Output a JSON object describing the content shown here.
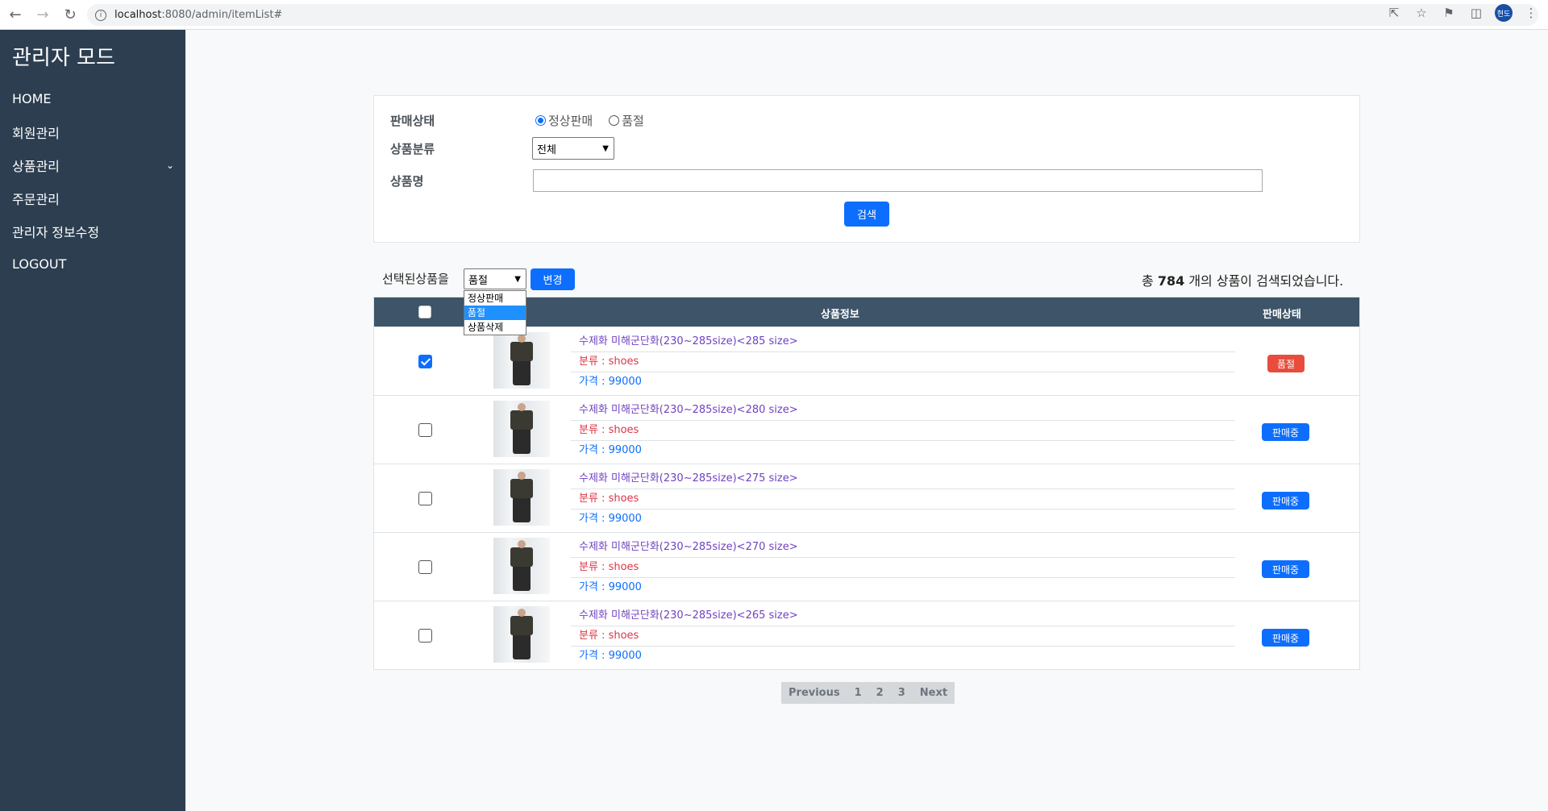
{
  "browser": {
    "url_host": "localhost",
    "url_rest": ":8080/admin/itemList#",
    "profile_initials": "현도"
  },
  "sidebar": {
    "title": "관리자 모드",
    "items": [
      {
        "label": "HOME"
      },
      {
        "label": "회원관리"
      },
      {
        "label": "상품관리"
      },
      {
        "label": "주문관리"
      },
      {
        "label": "관리자 정보수정"
      },
      {
        "label": "LOGOUT"
      }
    ]
  },
  "search": {
    "status_label": "판매상태",
    "status_options": [
      "정상판매",
      "품절"
    ],
    "status_selected": "정상판매",
    "category_label": "상품분류",
    "category_value": "전체",
    "name_label": "상품명",
    "name_value": "",
    "search_button": "검색"
  },
  "bulk": {
    "label": "선택된상품을",
    "selected": "품절",
    "options": [
      "정상판매",
      "품절",
      "상품삭제"
    ],
    "change_button": "변경"
  },
  "summary": {
    "prefix": "총",
    "count": "784",
    "suffix": "개의 상품이 검색되었습니다."
  },
  "table": {
    "headers": {
      "info": "상품정보",
      "status": "판매상태"
    },
    "rows": [
      {
        "checked": true,
        "name": "수제화 미해군단화(230~285size)<285 size>",
        "category": "분류 : shoes",
        "price": "가격 : 99000",
        "status": "품절",
        "status_color": "#e74c3c"
      },
      {
        "checked": false,
        "name": "수제화 미해군단화(230~285size)<280 size>",
        "category": "분류 : shoes",
        "price": "가격 : 99000",
        "status": "판매중",
        "status_color": "#0d6efd"
      },
      {
        "checked": false,
        "name": "수제화 미해군단화(230~285size)<275 size>",
        "category": "분류 : shoes",
        "price": "가격 : 99000",
        "status": "판매중",
        "status_color": "#0d6efd"
      },
      {
        "checked": false,
        "name": "수제화 미해군단화(230~285size)<270 size>",
        "category": "분류 : shoes",
        "price": "가격 : 99000",
        "status": "판매중",
        "status_color": "#0d6efd"
      },
      {
        "checked": false,
        "name": "수제화 미해군단화(230~285size)<265 size>",
        "category": "분류 : shoes",
        "price": "가격 : 99000",
        "status": "판매중",
        "status_color": "#0d6efd"
      }
    ]
  },
  "pagination": {
    "previous": "Previous",
    "pages": [
      "1",
      "2",
      "3"
    ],
    "next": "Next"
  },
  "colors": {
    "sidebar_bg": "#2c3e50",
    "table_header_bg": "#3e5468",
    "primary": "#0d6efd",
    "danger": "#e74c3c"
  }
}
